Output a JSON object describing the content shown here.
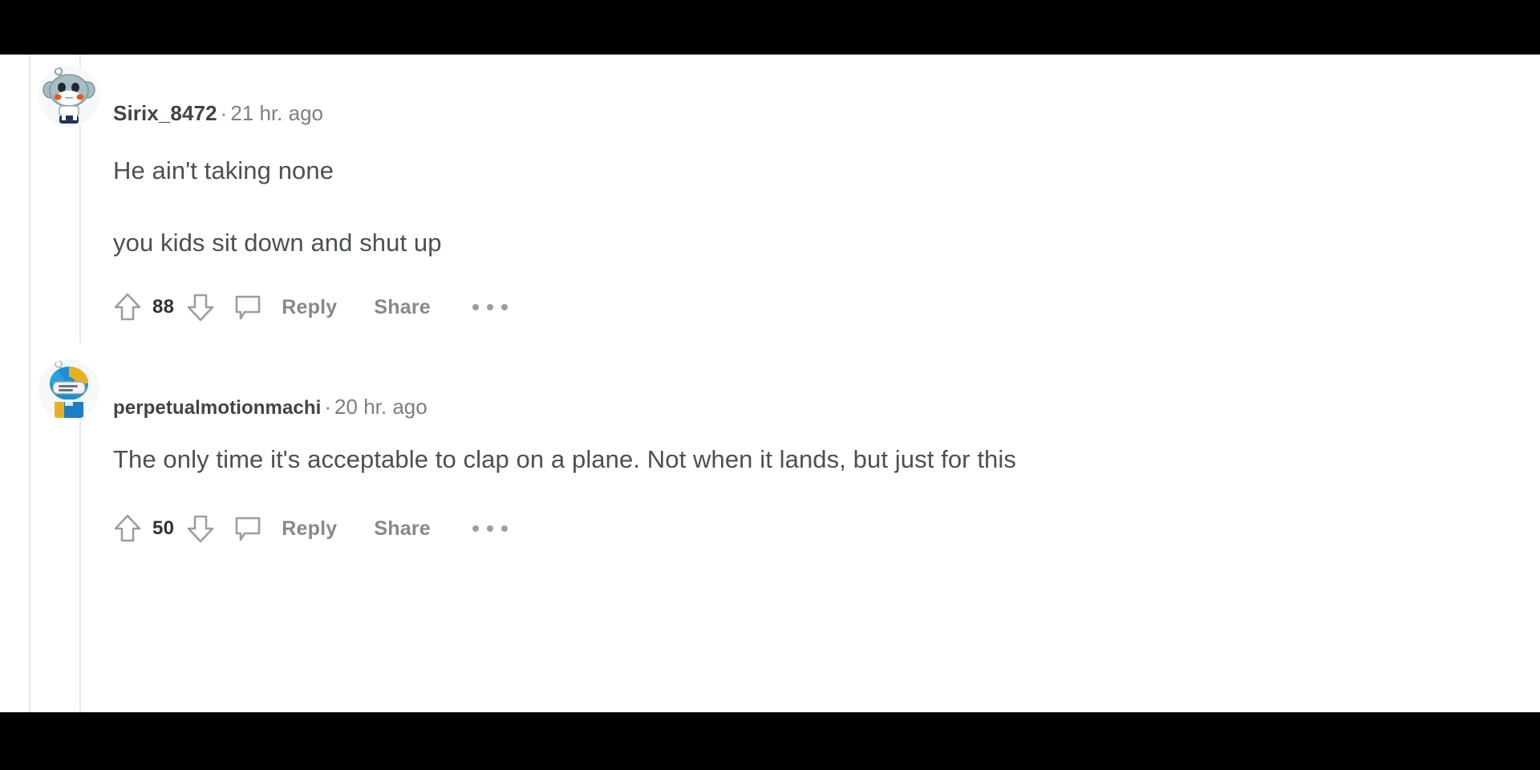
{
  "app": {
    "platform": "reddit-comment-thread",
    "background_color": "#ffffff",
    "letterbox_color": "#000000",
    "thread_line_color": "#e6e7e8",
    "body_text_color": "#4c5053",
    "meta_text_color": "#7c7f82",
    "action_label_color": "#86898c"
  },
  "comments": [
    {
      "username": "Sirix_8472",
      "separator": "·",
      "timestamp": "21 hr. ago",
      "avatar_name": "avatar-sirix-8472",
      "paragraphs": [
        "He ain't taking none",
        "you kids sit down and shut up"
      ],
      "score": "88",
      "upvote_label": "upvote",
      "downvote_label": "downvote",
      "comment_icon_label": "comment",
      "reply_label": "Reply",
      "share_label": "Share",
      "more_label": "more options"
    },
    {
      "username": "perpetualmotionmachi",
      "separator": "·",
      "timestamp": "20 hr. ago",
      "avatar_name": "avatar-perpetualmotionmachi",
      "paragraphs": [
        "The only time it's acceptable to clap on a plane. Not when it lands, but just for this"
      ],
      "score": "50",
      "upvote_label": "upvote",
      "downvote_label": "downvote",
      "comment_icon_label": "comment",
      "reply_label": "Reply",
      "share_label": "Share",
      "more_label": "more options"
    }
  ]
}
